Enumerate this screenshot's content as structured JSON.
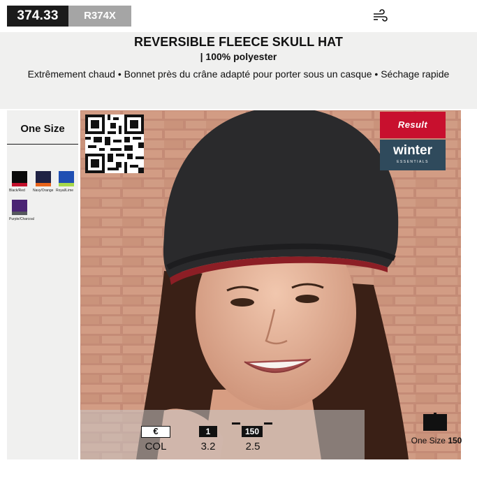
{
  "header": {
    "price": "374.33",
    "sku": "R374X",
    "wind_icon": "wind-icon"
  },
  "product": {
    "title": "REVERSIBLE FLEECE SKULL HAT",
    "material": "| 100% polyester",
    "features": "Extrêmement chaud • Bonnet près du crâne adapté pour porter sous un casque • Séchage rapide"
  },
  "sizes": {
    "label": "One Size"
  },
  "swatches": [
    {
      "name": "Black/Red",
      "top": "#0a0a0a",
      "band": "#c3102b"
    },
    {
      "name": "Navy/Orange",
      "top": "#1f2244",
      "band": "#e8641b"
    },
    {
      "name": "Royal/Lime",
      "top": "#1f4fb3",
      "band": "#a6d94a"
    },
    {
      "name": "Purple/Charcoal",
      "top": "#4b2474",
      "band": "#55575d"
    }
  ],
  "brand": {
    "result": "Result",
    "winter": "winter",
    "winter_sub": "ESSENTIALS",
    "colors": {
      "result": "#c8102e",
      "winter": "#2f4a5c"
    }
  },
  "pricing": {
    "currency_symbol": "€",
    "col_label": "COL",
    "qty_box_1": "1",
    "qty_box_2": "150",
    "value_1": "3.2",
    "value_2": "2.5"
  },
  "packaging": {
    "size_label": "One Size",
    "qty": "150"
  }
}
